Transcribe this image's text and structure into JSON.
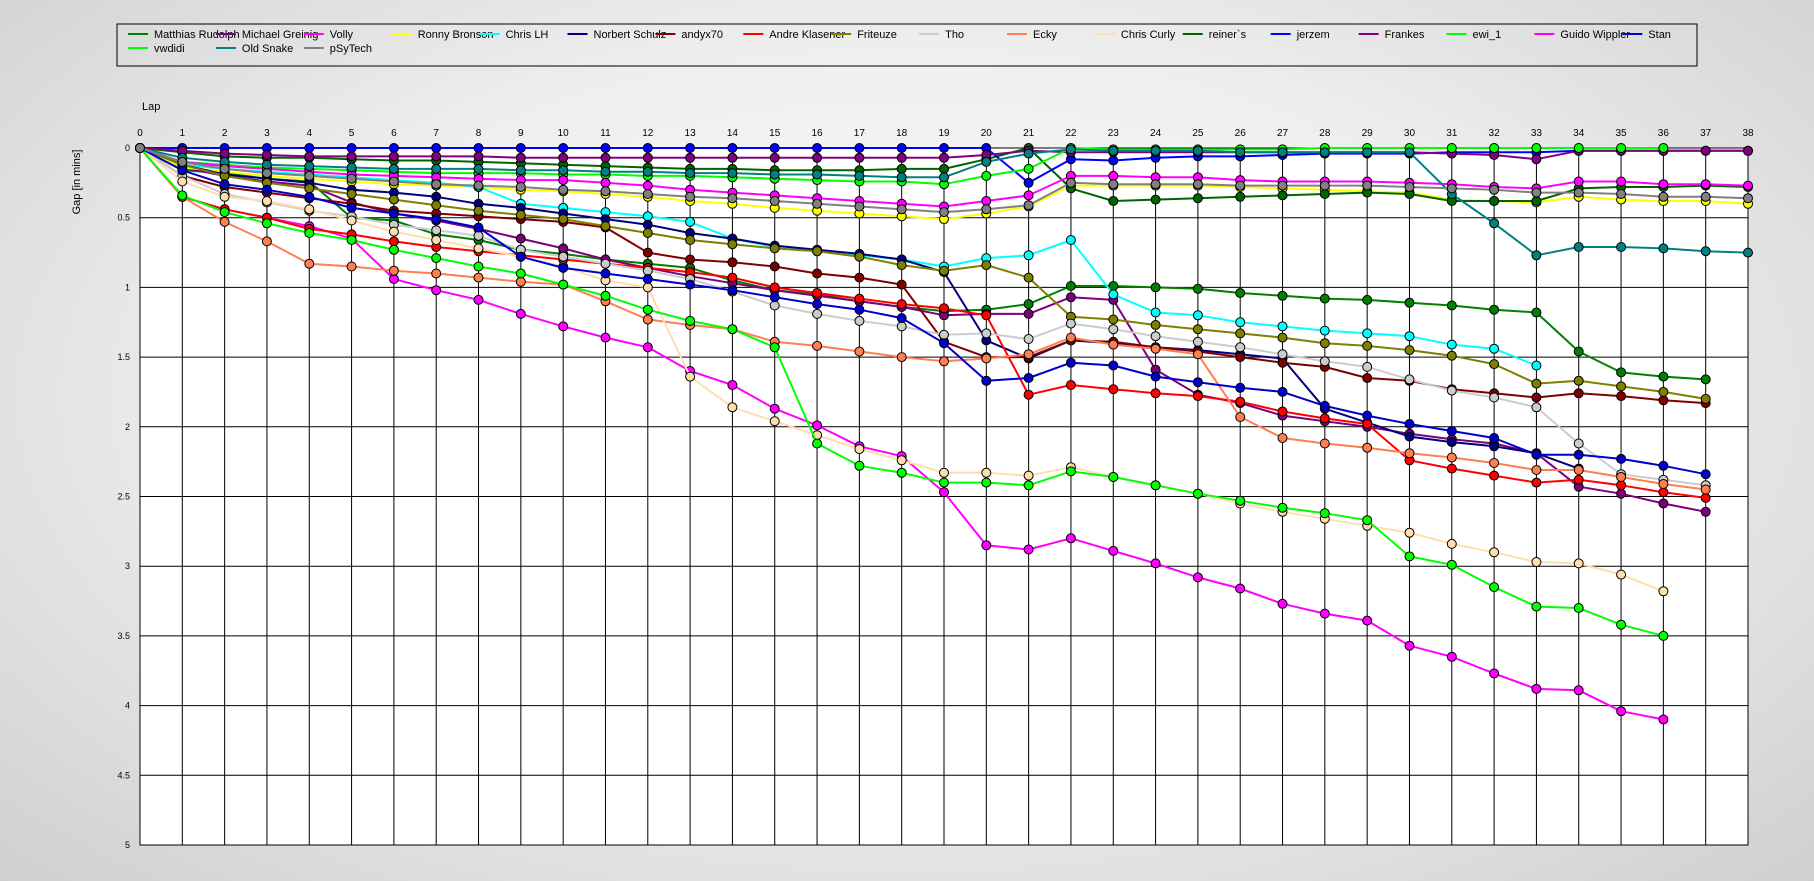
{
  "chart_data": {
    "type": "line",
    "x_axis_label": "Lap",
    "y_axis_label": "Gap [in mins]",
    "x_ticks": [
      0,
      1,
      2,
      3,
      4,
      5,
      6,
      7,
      8,
      9,
      10,
      11,
      12,
      13,
      14,
      15,
      16,
      17,
      18,
      19,
      20,
      21,
      22,
      23,
      24,
      25,
      26,
      27,
      28,
      29,
      30,
      31,
      32,
      33,
      34,
      35,
      36,
      37,
      38
    ],
    "xlim": [
      0,
      38
    ],
    "y_ticks": [
      0,
      0.5,
      1,
      1.5,
      2,
      2.5,
      3,
      3.5,
      4,
      4.5,
      5
    ],
    "ylim": [
      0,
      5
    ],
    "y_inverted": true,
    "grid": true,
    "legend_position": "top",
    "series": [
      {
        "name": "Matthias Rudolph",
        "color": "#007f00",
        "values": [
          0,
          0.16,
          0.18,
          0.22,
          0.24,
          0.5,
          0.52,
          0.62,
          0.66,
          0.73,
          0.76,
          0.8,
          0.83,
          0.86,
          0.95,
          1.02,
          1.05,
          1.1,
          1.14,
          1.17,
          1.16,
          1.12,
          0.99,
          0.99,
          1.0,
          1.01,
          1.04,
          1.06,
          1.08,
          1.09,
          1.11,
          1.13,
          1.16,
          1.18,
          1.46,
          1.61,
          1.64,
          1.66
        ]
      },
      {
        "name": "Michael Greinig",
        "color": "#7f007f",
        "values": [
          0,
          0.14,
          0.2,
          0.24,
          0.27,
          0.39,
          0.47,
          0.52,
          0.58,
          0.65,
          0.72,
          0.8,
          0.86,
          0.92,
          0.97,
          1.02,
          1.06,
          1.1,
          1.14,
          1.2,
          1.19,
          1.19,
          1.07,
          1.09,
          1.59,
          1.77,
          1.83,
          1.92,
          1.96,
          2.0,
          2.05,
          2.09,
          2.12,
          2.19,
          2.43,
          2.48,
          2.55,
          2.61
        ]
      },
      {
        "name": "Volly",
        "color": "#ff00ff",
        "values": [
          0,
          0.35,
          0.44,
          0.5,
          0.56,
          0.65,
          0.94,
          1.02,
          1.09,
          1.19,
          1.28,
          1.36,
          1.43,
          1.6,
          1.7,
          1.87,
          1.99,
          2.14,
          2.21,
          2.47,
          2.85,
          2.88,
          2.8,
          2.89,
          2.98,
          3.08,
          3.16,
          3.27,
          3.34,
          3.39,
          3.57,
          3.65,
          3.77,
          3.88,
          3.89,
          4.04,
          4.1
        ]
      },
      {
        "name": "Ronny Bronson",
        "color": "#ffff00",
        "values": [
          0,
          0.14,
          0.17,
          0.2,
          0.22,
          0.24,
          0.26,
          0.27,
          0.28,
          0.3,
          0.31,
          0.33,
          0.35,
          0.38,
          0.4,
          0.43,
          0.45,
          0.47,
          0.49,
          0.51,
          0.47,
          0.42,
          0.27,
          0.27,
          0.27,
          0.27,
          0.28,
          0.29,
          0.3,
          0.31,
          0.32,
          0.37,
          0.38,
          0.39,
          0.35,
          0.37,
          0.38,
          0.38,
          0.4
        ]
      },
      {
        "name": "Chris LH",
        "color": "#00ffff",
        "values": [
          0,
          0.12,
          0.15,
          0.17,
          0.19,
          0.21,
          0.23,
          0.25,
          0.28,
          0.4,
          0.43,
          0.46,
          0.49,
          0.53,
          0.65,
          0.71,
          0.74,
          0.77,
          0.8,
          0.85,
          0.79,
          0.77,
          0.66,
          1.05,
          1.18,
          1.2,
          1.25,
          1.28,
          1.31,
          1.33,
          1.35,
          1.41,
          1.44,
          1.56
        ]
      },
      {
        "name": "Norbert Schulz",
        "color": "#00007f",
        "values": [
          0,
          0.12,
          0.19,
          0.22,
          0.25,
          0.3,
          0.32,
          0.35,
          0.4,
          0.43,
          0.47,
          0.51,
          0.55,
          0.61,
          0.65,
          0.7,
          0.73,
          0.76,
          0.8,
          0.89,
          1.38,
          1.51,
          1.38,
          1.4,
          1.43,
          1.45,
          1.48,
          1.51,
          1.87,
          1.97,
          2.07,
          2.11,
          2.14,
          2.19,
          2.3
        ]
      },
      {
        "name": "andyx70",
        "color": "#7f0000",
        "values": [
          0,
          0.2,
          0.28,
          0.32,
          0.36,
          0.4,
          0.45,
          0.47,
          0.49,
          0.51,
          0.53,
          0.57,
          0.75,
          0.8,
          0.82,
          0.85,
          0.9,
          0.93,
          0.98,
          1.39,
          1.5,
          1.5,
          1.38,
          1.39,
          1.43,
          1.46,
          1.5,
          1.54,
          1.57,
          1.65,
          1.67,
          1.73,
          1.76,
          1.79,
          1.76,
          1.78,
          1.81,
          1.83
        ]
      },
      {
        "name": "Andre Klasener",
        "color": "#ff0000",
        "values": [
          0,
          0.35,
          0.44,
          0.5,
          0.58,
          0.62,
          0.67,
          0.71,
          0.74,
          0.77,
          0.8,
          0.83,
          0.86,
          0.89,
          0.93,
          1.0,
          1.04,
          1.08,
          1.12,
          1.15,
          1.2,
          1.77,
          1.7,
          1.73,
          1.76,
          1.78,
          1.82,
          1.89,
          1.94,
          1.98,
          2.24,
          2.3,
          2.35,
          2.4,
          2.38,
          2.42,
          2.47,
          2.51
        ]
      },
      {
        "name": "Friteuze",
        "color": "#7f7f00",
        "values": [
          0,
          0.12,
          0.2,
          0.25,
          0.29,
          0.33,
          0.37,
          0.41,
          0.45,
          0.48,
          0.51,
          0.56,
          0.61,
          0.66,
          0.69,
          0.72,
          0.74,
          0.78,
          0.84,
          0.88,
          0.84,
          0.93,
          1.21,
          1.23,
          1.27,
          1.3,
          1.33,
          1.36,
          1.4,
          1.42,
          1.45,
          1.49,
          1.55,
          1.69,
          1.67,
          1.71,
          1.75,
          1.8
        ]
      },
      {
        "name": "Tho",
        "color": "#cccccc",
        "values": [
          0,
          0.2,
          0.33,
          0.39,
          0.45,
          0.49,
          0.55,
          0.59,
          0.63,
          0.73,
          0.78,
          0.83,
          0.88,
          0.94,
          1.03,
          1.13,
          1.19,
          1.24,
          1.28,
          1.34,
          1.33,
          1.37,
          1.26,
          1.3,
          1.35,
          1.39,
          1.43,
          1.48,
          1.53,
          1.57,
          1.66,
          1.74,
          1.79,
          1.86,
          2.12,
          2.34,
          2.38,
          2.42
        ]
      },
      {
        "name": "Ecky",
        "color": "#ff7f50",
        "values": [
          0,
          0.35,
          0.53,
          0.67,
          0.83,
          0.85,
          0.88,
          0.9,
          0.93,
          0.96,
          0.98,
          1.1,
          1.23,
          1.27,
          1.3,
          1.39,
          1.42,
          1.46,
          1.5,
          1.53,
          1.51,
          1.48,
          1.36,
          1.41,
          1.44,
          1.48,
          1.93,
          2.08,
          2.12,
          2.15,
          2.19,
          2.22,
          2.26,
          2.31,
          2.31,
          2.36,
          2.41,
          2.45
        ]
      },
      {
        "name": "Chris Curly",
        "color": "#ffdead",
        "values": [
          0,
          0.24,
          0.35,
          0.38,
          0.44,
          0.52,
          0.6,
          0.66,
          0.72,
          0.78,
          0.85,
          0.95,
          1.0,
          1.64,
          1.86,
          1.96,
          2.06,
          2.16,
          2.24,
          2.33,
          2.33,
          2.35,
          2.29,
          2.36,
          2.42,
          2.48,
          2.55,
          2.61,
          2.66,
          2.71,
          2.76,
          2.84,
          2.9,
          2.97,
          2.98,
          3.06,
          3.18
        ]
      },
      {
        "name": "reiner`s",
        "color": "#006400",
        "values": [
          0,
          0.03,
          0.06,
          0.07,
          0.07,
          0.08,
          0.09,
          0.09,
          0.1,
          0.11,
          0.12,
          0.13,
          0.14,
          0.15,
          0.15,
          0.16,
          0.16,
          0.16,
          0.15,
          0.15,
          0.08,
          0.0,
          0.29,
          0.38,
          0.37,
          0.36,
          0.35,
          0.34,
          0.33,
          0.32,
          0.33,
          0.38,
          0.38,
          0.38,
          0.29,
          0.28,
          0.28,
          0.27,
          0.28
        ]
      },
      {
        "name": "jerzem",
        "color": "#0000ff",
        "values": [
          0,
          0.0,
          0.0,
          0.0,
          0.0,
          0.0,
          0.0,
          0.0,
          0.0,
          0.0,
          0.0,
          0.0,
          0.0,
          0.0,
          0.0,
          0.0,
          0.0,
          0.0,
          0.0,
          0.0,
          0.0,
          0.25,
          0.08,
          0.09,
          0.07,
          0.06,
          0.06,
          0.05,
          0.04,
          0.04,
          0.04,
          0.03,
          0.03,
          0.03,
          0.02,
          0.02,
          0.02,
          0.02,
          0.02
        ]
      },
      {
        "name": "Frankes",
        "color": "#800080",
        "values": [
          0,
          0.02,
          0.04,
          0.05,
          0.06,
          0.06,
          0.06,
          0.06,
          0.06,
          0.07,
          0.07,
          0.07,
          0.07,
          0.07,
          0.07,
          0.07,
          0.07,
          0.07,
          0.07,
          0.07,
          0.05,
          0.02,
          0.03,
          0.03,
          0.03,
          0.03,
          0.03,
          0.03,
          0.03,
          0.03,
          0.03,
          0.04,
          0.05,
          0.08,
          0.02,
          0.02,
          0.02,
          0.02,
          0.02
        ]
      },
      {
        "name": "ewi_1",
        "color": "#00ff00",
        "values": [
          0,
          0.1,
          0.12,
          0.14,
          0.15,
          0.16,
          0.17,
          0.18,
          0.18,
          0.18,
          0.19,
          0.19,
          0.2,
          0.2,
          0.21,
          0.22,
          0.23,
          0.24,
          0.24,
          0.26,
          0.2,
          0.15,
          0.0,
          0.01,
          0.01,
          0.01,
          0.01,
          0.01,
          0.0,
          0.0,
          0.0,
          0.0,
          0.0,
          0.0,
          0.0,
          0.0,
          0.0
        ]
      },
      {
        "name": "Guido Wippler",
        "color": "#ff00ff",
        "values": [
          0,
          0.1,
          0.13,
          0.15,
          0.17,
          0.19,
          0.2,
          0.21,
          0.22,
          0.23,
          0.23,
          0.25,
          0.27,
          0.3,
          0.32,
          0.34,
          0.36,
          0.38,
          0.4,
          0.42,
          0.38,
          0.34,
          0.2,
          0.2,
          0.21,
          0.21,
          0.23,
          0.24,
          0.24,
          0.24,
          0.25,
          0.26,
          0.28,
          0.29,
          0.24,
          0.24,
          0.26,
          0.26,
          0.27
        ]
      },
      {
        "name": "Stan",
        "color": "#0000cd",
        "values": [
          0,
          0.16,
          0.26,
          0.3,
          0.35,
          0.43,
          0.47,
          0.51,
          0.57,
          0.78,
          0.86,
          0.9,
          0.94,
          0.98,
          1.02,
          1.07,
          1.12,
          1.16,
          1.22,
          1.4,
          1.67,
          1.65,
          1.54,
          1.56,
          1.64,
          1.68,
          1.72,
          1.75,
          1.85,
          1.92,
          1.98,
          2.03,
          2.08,
          2.2,
          2.2,
          2.23,
          2.28,
          2.34
        ]
      },
      {
        "name": "vwdidi",
        "color": "#00ff00",
        "values": [
          0,
          0.34,
          0.46,
          0.54,
          0.61,
          0.66,
          0.73,
          0.79,
          0.85,
          0.9,
          0.98,
          1.06,
          1.16,
          1.24,
          1.3,
          1.43,
          2.12,
          2.28,
          2.33,
          2.4,
          2.4,
          2.42,
          2.32,
          2.36,
          2.42,
          2.48,
          2.53,
          2.58,
          2.62,
          2.67,
          2.93,
          2.99,
          3.15,
          3.29,
          3.3,
          3.42,
          3.5
        ]
      },
      {
        "name": "Old Snake",
        "color": "#008080",
        "values": [
          0,
          0.07,
          0.1,
          0.12,
          0.13,
          0.14,
          0.15,
          0.15,
          0.15,
          0.16,
          0.16,
          0.17,
          0.17,
          0.18,
          0.18,
          0.19,
          0.19,
          0.2,
          0.21,
          0.21,
          0.1,
          0.04,
          0.01,
          0.02,
          0.02,
          0.02,
          0.03,
          0.03,
          0.03,
          0.03,
          0.03,
          0.33,
          0.54,
          0.77,
          0.71,
          0.71,
          0.72,
          0.74,
          0.75
        ]
      },
      {
        "name": "pSyTech",
        "color": "#808080",
        "values": [
          0,
          0.1,
          0.15,
          0.18,
          0.2,
          0.22,
          0.24,
          0.26,
          0.27,
          0.28,
          0.3,
          0.31,
          0.33,
          0.35,
          0.36,
          0.38,
          0.4,
          0.42,
          0.44,
          0.46,
          0.44,
          0.41,
          0.25,
          0.26,
          0.26,
          0.26,
          0.27,
          0.27,
          0.27,
          0.27,
          0.28,
          0.29,
          0.3,
          0.32,
          0.32,
          0.33,
          0.35,
          0.35,
          0.36
        ]
      }
    ]
  }
}
